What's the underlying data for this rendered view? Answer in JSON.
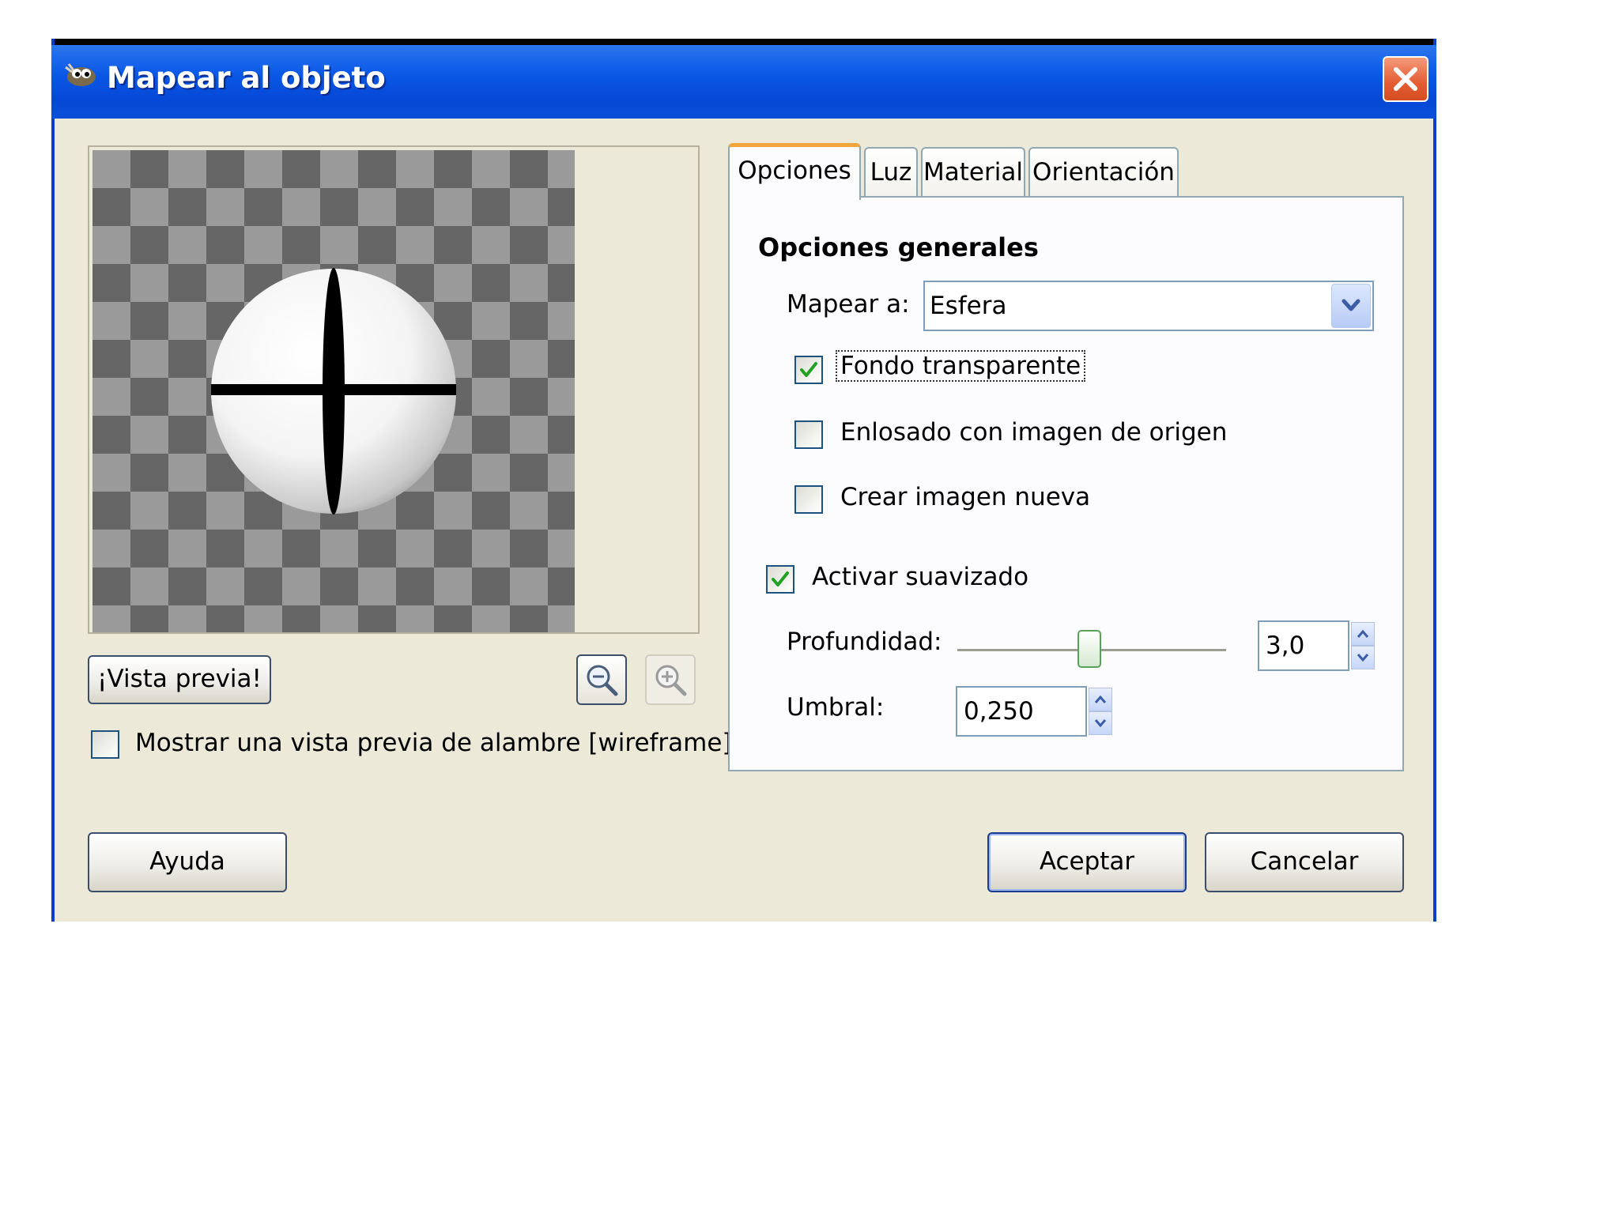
{
  "window": {
    "title": "Mapear al objeto"
  },
  "preview": {
    "preview_button": "¡Vista previa!",
    "wireframe_label": "Mostrar una vista previa de alambre [wireframe]",
    "wireframe_checked": false
  },
  "tabs": [
    {
      "label": "Opciones",
      "active": true
    },
    {
      "label": "Luz",
      "active": false
    },
    {
      "label": "Material",
      "active": false
    },
    {
      "label": "Orientación",
      "active": false
    }
  ],
  "options": {
    "section_title": "Opciones generales",
    "map_to_label": "Mapear a:",
    "map_to_value": "Esfera",
    "transparent_bg_label": "Fondo transparente",
    "transparent_bg_checked": true,
    "tile_source_label": "Enlosado con imagen de origen",
    "tile_source_checked": false,
    "new_image_label": "Crear imagen nueva",
    "new_image_checked": false,
    "antialias_label": "Activar suavizado",
    "antialias_checked": true,
    "depth_label": "Profundidad:",
    "depth_value": "3,0",
    "threshold_label": "Umbral:",
    "threshold_value": "0,250"
  },
  "buttons": {
    "help": "Ayuda",
    "ok": "Aceptar",
    "cancel": "Cancelar"
  },
  "colors": {
    "titlebar": "#0a58e6",
    "dialog_bg": "#ece9d8",
    "checkmark": "#21a121",
    "tab_highlight": "#f2a53a"
  }
}
